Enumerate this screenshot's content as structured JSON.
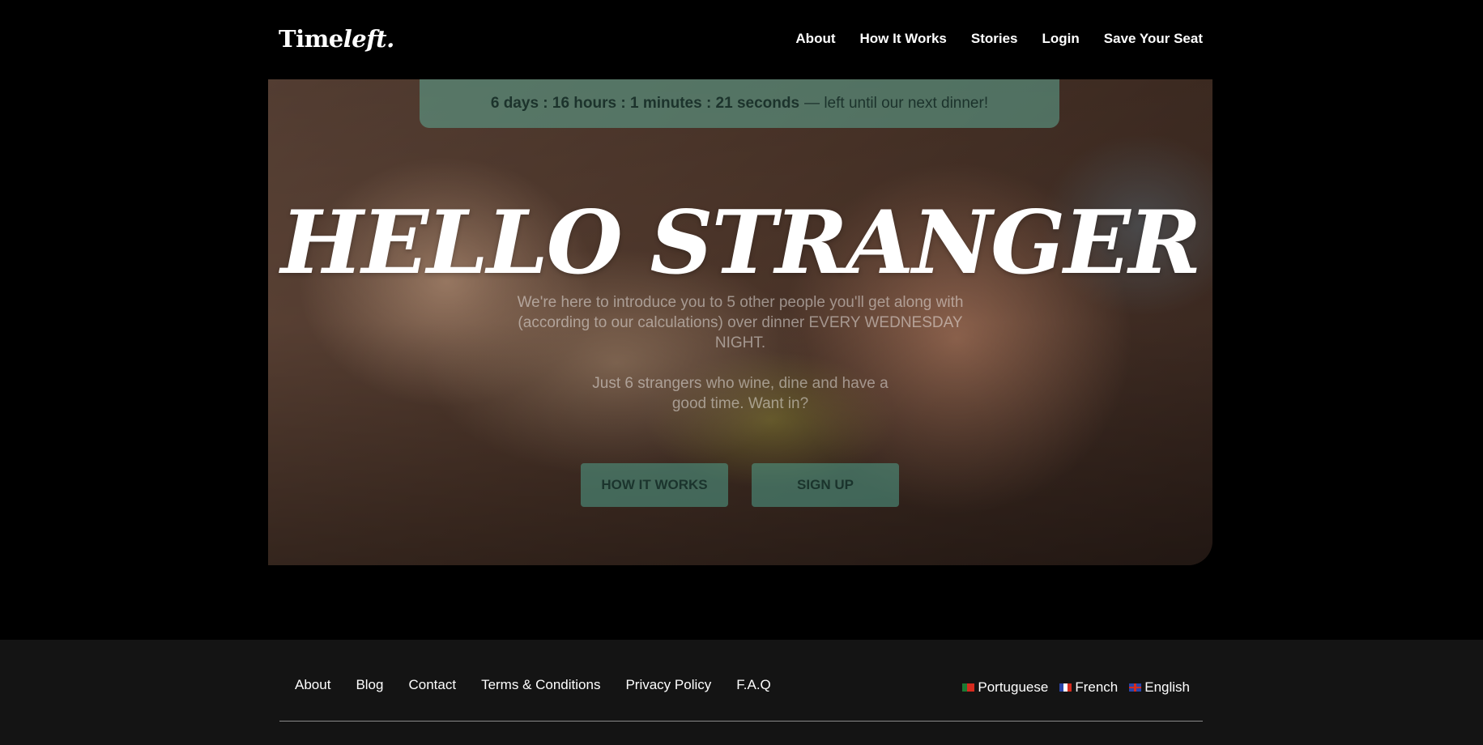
{
  "nav": {
    "logo": {
      "part1": "Time",
      "part2": "left."
    },
    "links": [
      "About",
      "How It Works",
      "Stories",
      "Login",
      "Save Your Seat"
    ]
  },
  "hero": {
    "countdown_time": "6 days : 16 hours : 1 minutes : 21 seconds",
    "countdown_suffix": "— left until our next dinner!",
    "headline": "HELLO STRANGER",
    "intro": "We're here to introduce you to 5 other people you'll get along with (according to our calculations) over dinner EVERY WEDNESDAY NIGHT.",
    "intro2": "Just 6 strangers who wine, dine and have a good time. Want in?",
    "buttons": {
      "how": "HOW IT WORKS",
      "signup": "SIGN UP"
    }
  },
  "footer": {
    "links": [
      "About",
      "Blog",
      "Contact",
      "Terms & Conditions",
      "Privacy Policy",
      "F.A.Q"
    ],
    "languages": [
      {
        "label": "Portuguese",
        "flag": "pt-flag-icon"
      },
      {
        "label": "French",
        "flag": "fr-flag-icon"
      },
      {
        "label": "English",
        "flag": "gb-flag-icon"
      }
    ]
  }
}
